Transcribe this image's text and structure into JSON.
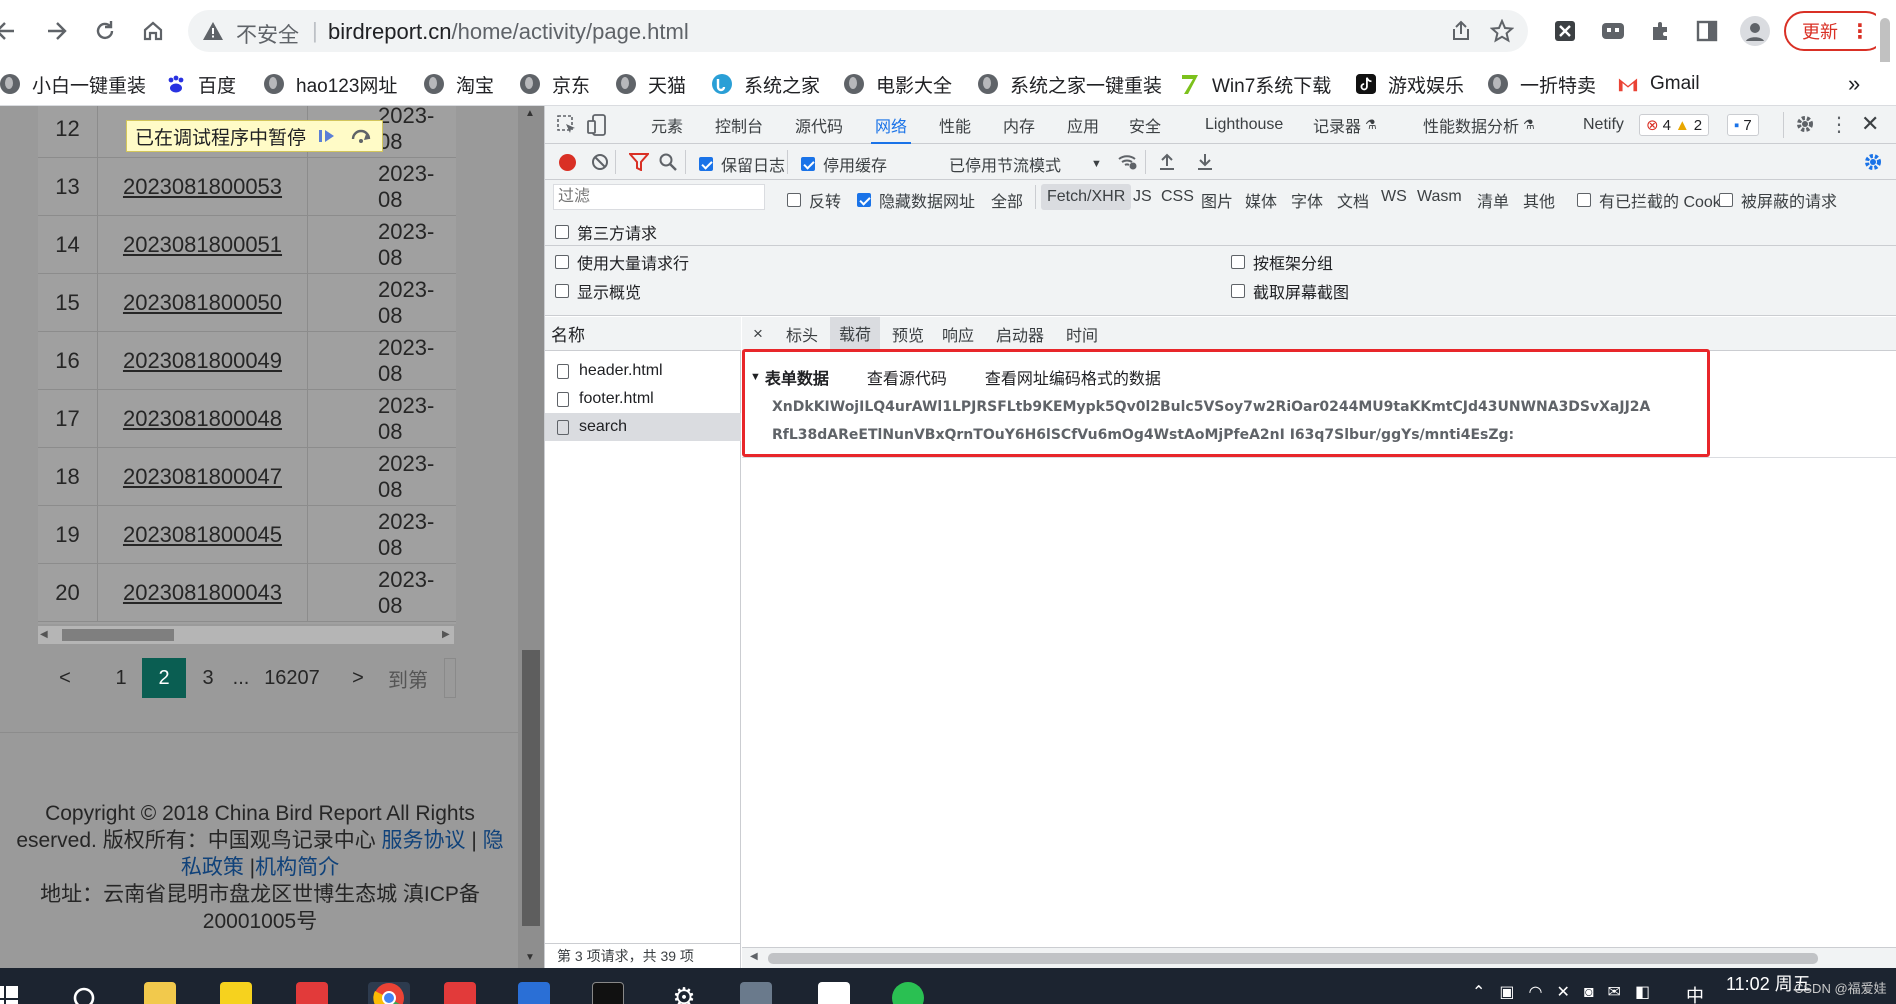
{
  "browser": {
    "insecure_label": "不安全",
    "url_host": "birdreport.cn",
    "url_path": "/home/activity/page.html",
    "update_label": "更新"
  },
  "bookmarks": [
    {
      "label": "小白一键重装",
      "icon": "globe-icon"
    },
    {
      "label": "百度",
      "icon": "baidu-icon"
    },
    {
      "label": "hao123网址",
      "icon": "globe-icon"
    },
    {
      "label": "淘宝",
      "icon": "globe-icon"
    },
    {
      "label": "京东",
      "icon": "globe-icon"
    },
    {
      "label": "天猫",
      "icon": "globe-icon"
    },
    {
      "label": "系统之家",
      "icon": "system-home-icon"
    },
    {
      "label": "电影大全",
      "icon": "globe-icon"
    },
    {
      "label": "系统之家一键重装",
      "icon": "globe-icon"
    },
    {
      "label": "Win7系统下载",
      "icon": "seven-icon"
    },
    {
      "label": "游戏娱乐",
      "icon": "tiktok-icon"
    },
    {
      "label": "一折特卖",
      "icon": "globe-icon"
    },
    {
      "label": "Gmail",
      "icon": "gmail-icon"
    }
  ],
  "page": {
    "debug_paused": "已在调试程序中暂停",
    "rows": [
      {
        "num": "12",
        "id": "",
        "date": "2023-08"
      },
      {
        "num": "13",
        "id": "2023081800053",
        "date": "2023-08"
      },
      {
        "num": "14",
        "id": "2023081800051",
        "date": "2023-08"
      },
      {
        "num": "15",
        "id": "2023081800050",
        "date": "2023-08"
      },
      {
        "num": "16",
        "id": "2023081800049",
        "date": "2023-08"
      },
      {
        "num": "17",
        "id": "2023081800048",
        "date": "2023-08"
      },
      {
        "num": "18",
        "id": "2023081800047",
        "date": "2023-08"
      },
      {
        "num": "19",
        "id": "2023081800045",
        "date": "2023-08"
      },
      {
        "num": "20",
        "id": "2023081800043",
        "date": "2023-08"
      }
    ],
    "pager": {
      "prev": "<",
      "pages": [
        "1",
        "2",
        "3",
        "...",
        "16207"
      ],
      "active": "2",
      "next": ">",
      "goto": "到第"
    },
    "footer": {
      "line1": "Copyright © 2018 China Bird Report All Rights",
      "line2a": "eserved.   版权所有：中国观鸟记录中心",
      "service": "服务协议",
      "sep": " | ",
      "privacy_a": "隐",
      "privacy_b": "私政策",
      "about": "机构简介",
      "bar": " |",
      "address": "地址：云南省昆明市盘龙区世博生态城     滇ICP备",
      "icp": "20001005号"
    }
  },
  "devtools": {
    "tabs": [
      "元素",
      "控制台",
      "源代码",
      "网络",
      "性能",
      "内存",
      "应用",
      "安全",
      "Lighthouse",
      "记录器",
      "性能数据分析",
      "Netify"
    ],
    "active_tab": "网络",
    "errors": "4",
    "warnings": "2",
    "messages": "7",
    "toolbar": {
      "preserve_log": "保留日志",
      "disable_cache": "停用缓存",
      "throttle": "已停用节流模式"
    },
    "filter": {
      "placeholder": "过滤",
      "invert": "反转",
      "hide_data_urls": "隐藏数据网址",
      "all": "全部",
      "types": [
        "Fetch/XHR",
        "JS",
        "CSS",
        "图片",
        "媒体",
        "字体",
        "文档",
        "WS",
        "Wasm",
        "清单",
        "其他"
      ],
      "blocked_cookies": "有已拦截的 Cookie",
      "blocked_requests": "被屏蔽的请求",
      "third_party": "第三方请求"
    },
    "options": {
      "big_rows": "使用大量请求行",
      "overview": "显示概览",
      "group_by_frame": "按框架分组",
      "screenshots": "截取屏幕截图"
    },
    "list": {
      "header": "名称",
      "requests": [
        "header.html",
        "footer.html",
        "search"
      ],
      "selected": "search",
      "status": "第 3 项请求，共 39 项"
    },
    "detail": {
      "close": "×",
      "tabs": [
        "标头",
        "载荷",
        "预览",
        "响应",
        "启动器",
        "时间"
      ],
      "active_tab": "载荷",
      "section": "表单数据",
      "view_source": "查看源代码",
      "view_url_encoded": "查看网址编码格式的数据",
      "payload_line1": "XnDkKIWojILQ4urAWl1LPJRSFLtb9KEMypk5Qv0l2Bulc5VSoy7w2RiOar0244MU9taKKmtCJd43UNWNA3DSvXaJJ2A",
      "payload_line2": "RfL38dAReETlNunVBxQrnTOuY6H6lSCfVu6mOg4WstAoMjPfeA2nI I63q7Slbur/ggYs/mnti4EsZg:"
    }
  },
  "taskbar": {
    "clock": "11:02 周五",
    "tray_text": "CSDN @福爱娃"
  },
  "colors": {
    "accent": "#1a73e8",
    "highlight_box": "#e8262a",
    "pager_active": "#0a5e52",
    "update": "#d93025"
  }
}
